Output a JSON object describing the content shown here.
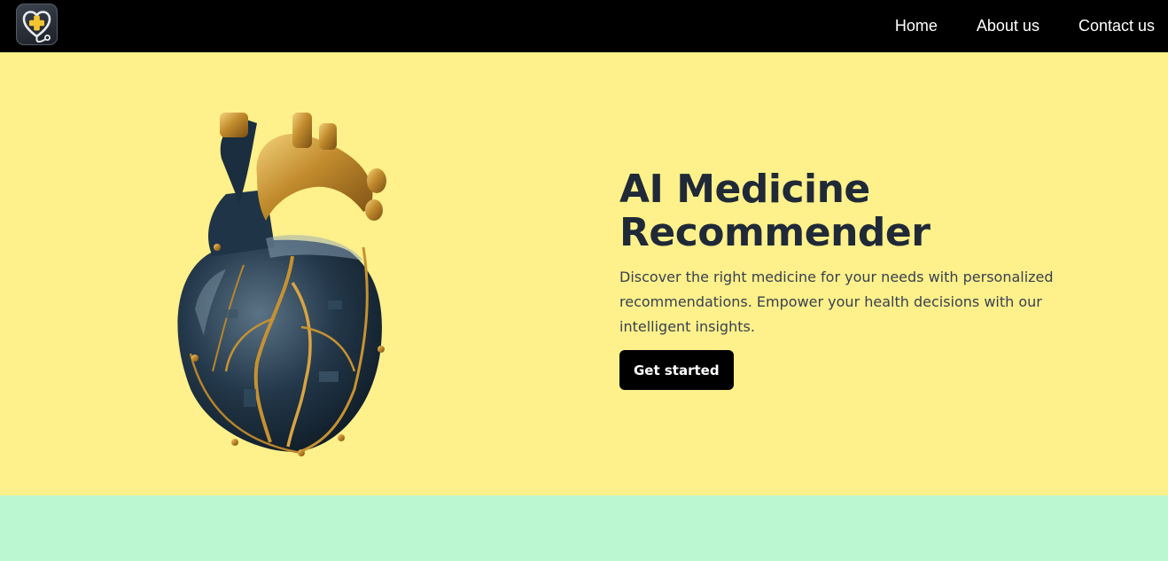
{
  "nav": {
    "logo_icon": "heart-stethoscope-plus-icon",
    "links": [
      "Home",
      "About us",
      "Contact us"
    ]
  },
  "hero": {
    "title_line1": "AI Medicine",
    "title_line2": "Recommender",
    "description": "Discover the right medicine for your needs with personalized recommendations. Empower your health decisions with our intelligent insights.",
    "cta_label": "Get started",
    "image_icon": "mechanical-heart-image"
  },
  "colors": {
    "navbar_bg": "#000000",
    "hero_bg": "#fef08a",
    "band_bg": "#bbf7d0",
    "title": "#1f2937",
    "button_bg": "#000000"
  }
}
